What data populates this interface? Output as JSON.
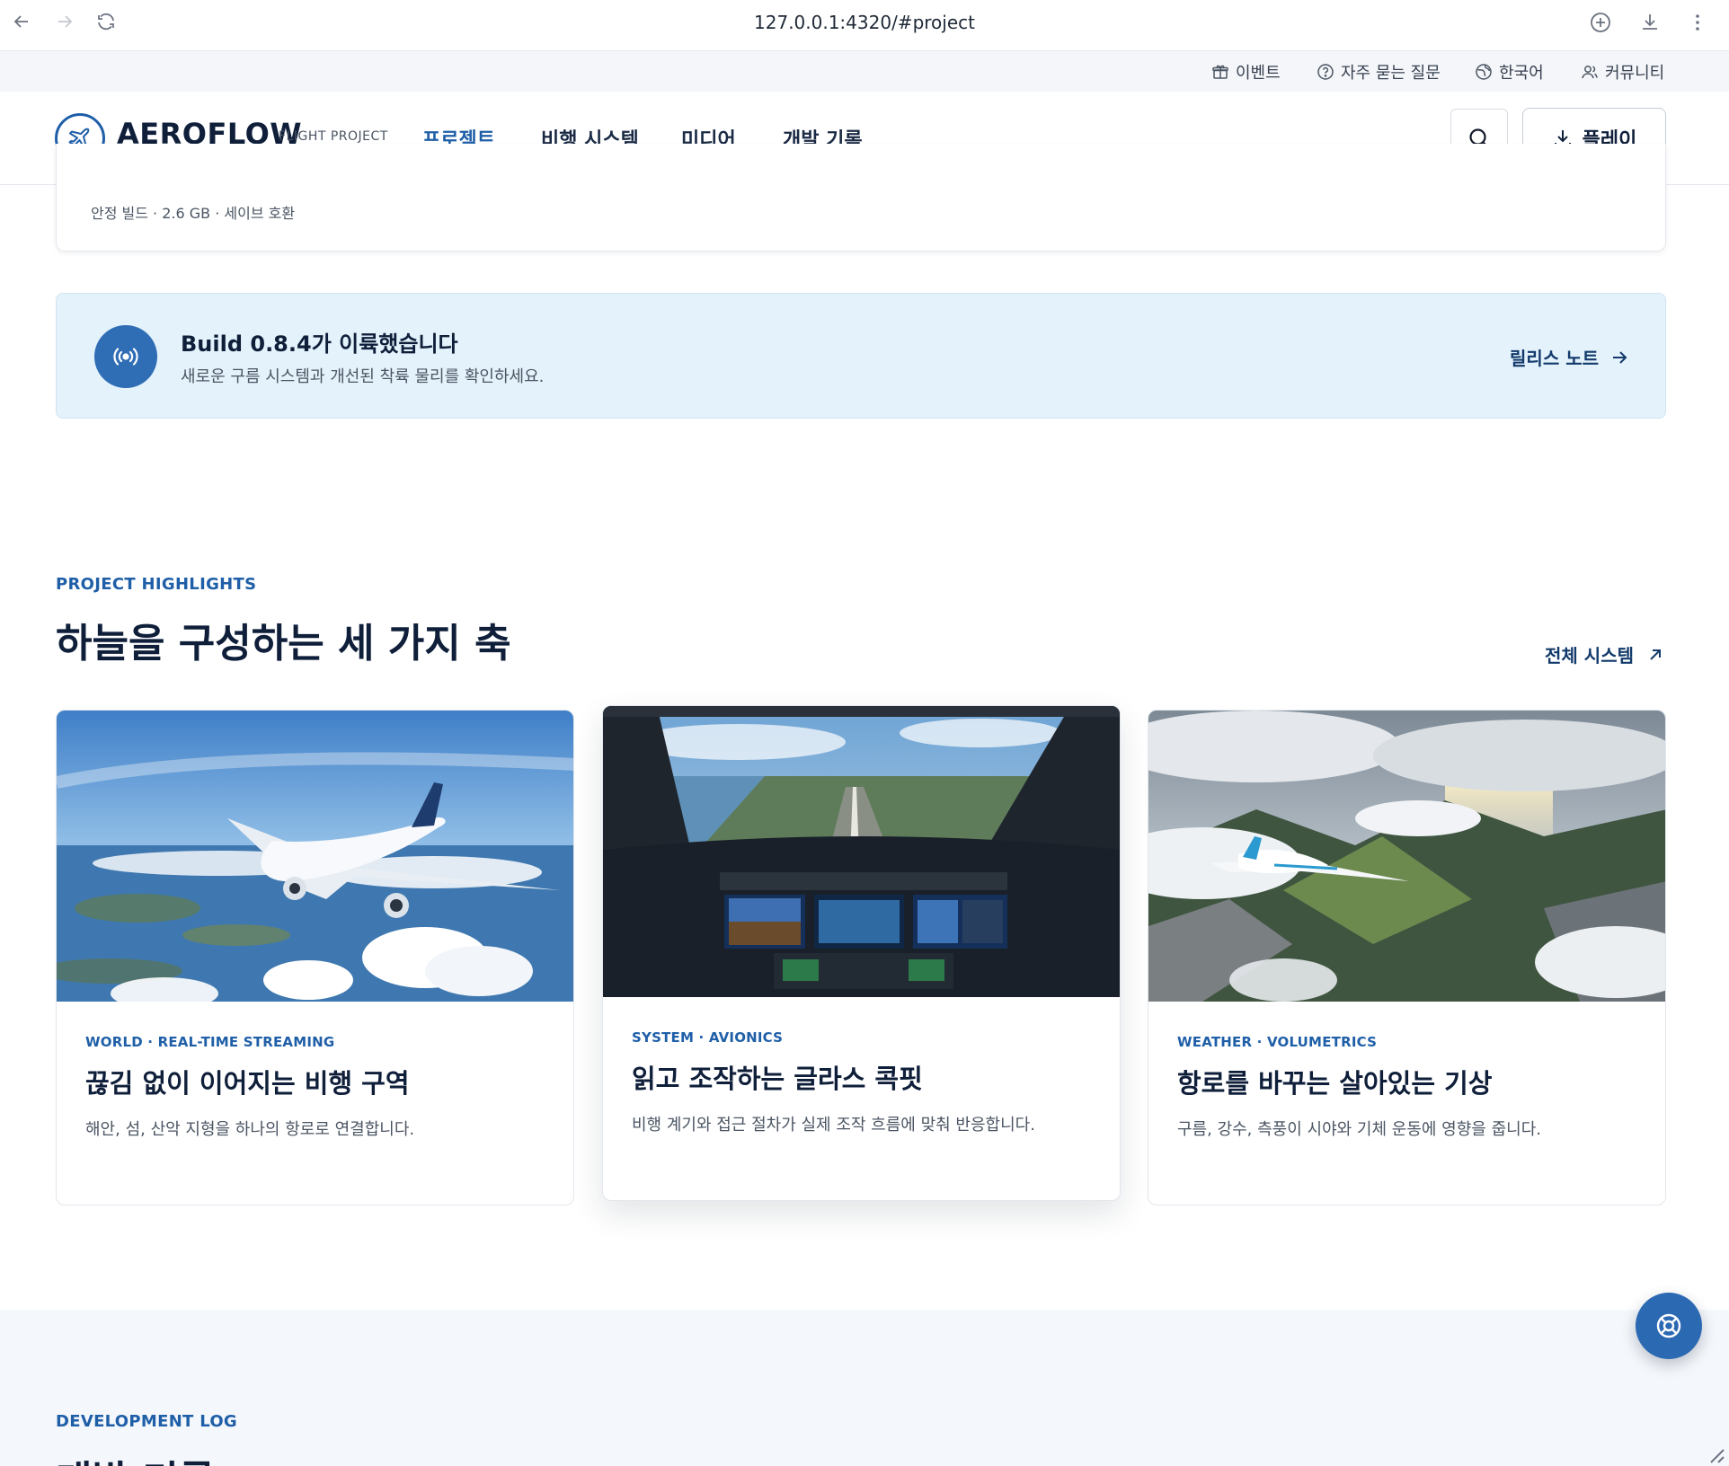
{
  "browser": {
    "url": "127.0.0.1:4320/#project"
  },
  "utility_bar": {
    "items": [
      {
        "label": "이벤트",
        "icon": "gift-icon"
      },
      {
        "label": "자주 묻는 질문",
        "icon": "help-circle-icon"
      },
      {
        "label": "한국어",
        "icon": "globe-icon"
      },
      {
        "label": "커뮤니티",
        "icon": "users-icon"
      }
    ]
  },
  "header": {
    "logo_text": "AEROFLOW",
    "logo_sub": "FLIGHT PROJECT",
    "nav": [
      {
        "label": "프로젝트",
        "active": true
      },
      {
        "label": "비행 시스템",
        "active": false
      },
      {
        "label": "미디어",
        "active": false
      },
      {
        "label": "개발 기록",
        "active": false
      }
    ],
    "play_label": "플레이"
  },
  "download": {
    "meta": "안정 빌드 · 2.6 GB · 세이브 호환"
  },
  "notice": {
    "title": "Build 0.8.4가 이륙했습니다",
    "description": "새로운 구름 시스템과 개선된 착륙 물리를 확인하세요.",
    "link": "릴리스 노트"
  },
  "highlights": {
    "eyebrow": "PROJECT HIGHLIGHTS",
    "title": "하늘을 구성하는 세 가지 축",
    "link": "전체 시스템",
    "cards": [
      {
        "tag": "WORLD · REAL-TIME STREAMING",
        "title": "끊김 없이 이어지는 비행 구역",
        "description": "해안, 섬, 산악 지형을 하나의 항로로 연결합니다."
      },
      {
        "tag": "SYSTEM · AVIONICS",
        "title": "읽고 조작하는 글라스 콕핏",
        "description": "비행 계기와 접근 절차가 실제 조작 흐름에 맞춰 반응합니다."
      },
      {
        "tag": "WEATHER · VOLUMETRICS",
        "title": "항로를 바꾸는 살아있는 기상",
        "description": "구름, 강수, 측풍이 시야와 기체 운동에 영향을 줍니다."
      }
    ]
  },
  "dev_log": {
    "eyebrow": "DEVELOPMENT LOG",
    "title": "개발 기록"
  },
  "colors": {
    "accent": "#1f5fa8",
    "navy": "#0f1f3a",
    "notice_bg": "#e4f2fb"
  }
}
